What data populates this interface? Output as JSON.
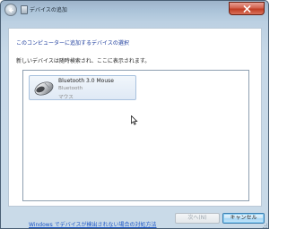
{
  "window": {
    "title": "デバイスの追加",
    "colors": {
      "heading": "#1c3c9c",
      "link": "#1a55c7",
      "close": "#c13d24"
    }
  },
  "page": {
    "heading": "このコンピューターに追加するデバイスの選択",
    "subtext": "新しいデバイスは随時検索され、ここに表示されます。"
  },
  "devices": [
    {
      "name": "Bluetooth 3.0 Mouse",
      "type": "Bluetooth",
      "category": "マウス",
      "icon": "mouse-icon"
    }
  ],
  "footer": {
    "help_link": "Windows でデバイスが検出されない場合の対処方法",
    "next_label": "次へ(N)",
    "cancel_label": "キャンセル"
  }
}
